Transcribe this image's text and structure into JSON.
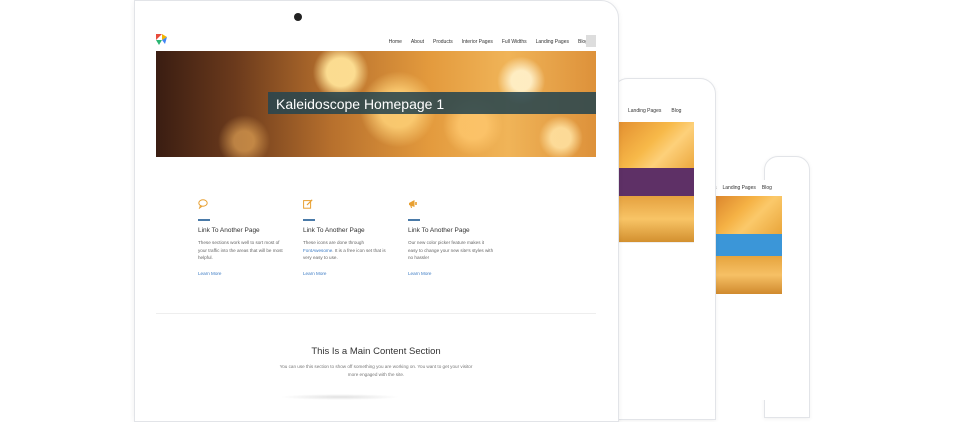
{
  "colors": {
    "accent_link": "#3b7bc4",
    "hero_band": "#28464e",
    "tablet_band": "#5e3066",
    "phone_band": "#3b96d8"
  },
  "nav": {
    "items": [
      "Home",
      "About",
      "Products",
      "Interior Pages",
      "Full Widths",
      "Landing Pages",
      "Blog"
    ]
  },
  "hero": {
    "title": "Kaleidoscope Homepage 1"
  },
  "features": [
    {
      "icon": "speech-bubble-icon",
      "title": "Link To Another Page",
      "body": "These sections work well to sort most of your traffic into the areas that will be most helpful.",
      "link": "Learn More"
    },
    {
      "icon": "edit-icon",
      "title": "Link To Another Page",
      "body_pre": "These icons are done through",
      "body_link": "FontAwesome",
      "body_post": ". It is a free icon set that is very easy to use.",
      "link": "Learn More"
    },
    {
      "icon": "megaphone-icon",
      "title": "Link To Another Page",
      "body": "Our new color picker feature makes it easy to change your new site's styles with no hassle!",
      "link": "Learn More"
    }
  ],
  "main_section": {
    "title": "This Is a Main Content Section",
    "body": "You can use this section to show off something you are working on. You want to get your visitor more engaged with the site."
  },
  "tablet": {
    "nav": [
      "Landing Pages",
      "Blog"
    ]
  },
  "phone": {
    "nav": [
      "s",
      "Landing Pages",
      "Blog"
    ]
  }
}
